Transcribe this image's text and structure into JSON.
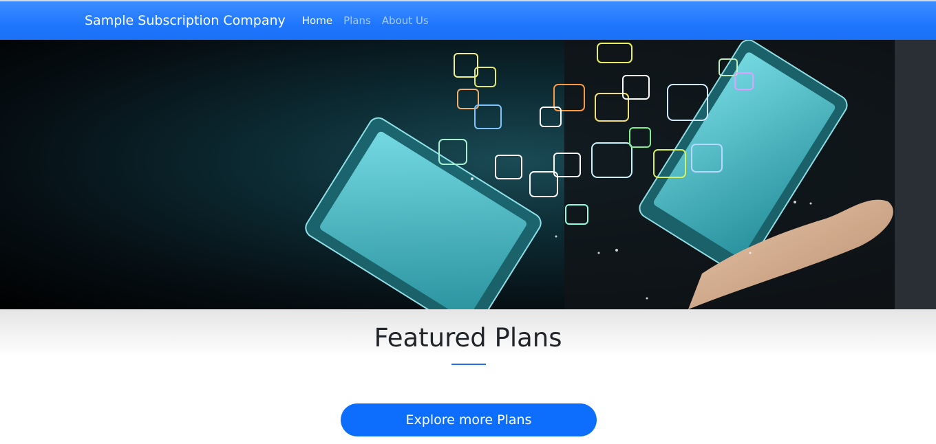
{
  "navbar": {
    "brand": "Sample Subscription Company",
    "links": [
      {
        "label": "Home",
        "active": true
      },
      {
        "label": "Plans",
        "active": false
      },
      {
        "label": "About Us",
        "active": false
      }
    ]
  },
  "hero": {
    "image": "hand-holding-tablets-with-app-icons",
    "icons": [
      "cloud-icon",
      "phone-icon",
      "globe-icon",
      "search-icon",
      "email-icon",
      "wifi-icon",
      "key-icon",
      "tablet-icon",
      "at-icon",
      "play-icon"
    ]
  },
  "featured": {
    "title": "Featured Plans",
    "accent_color": "#1f6fe5",
    "cta_label": "Explore more Plans",
    "cta_color": "#0d6efd"
  },
  "colors": {
    "navbar": "#1f77ff",
    "text": "#212529"
  }
}
